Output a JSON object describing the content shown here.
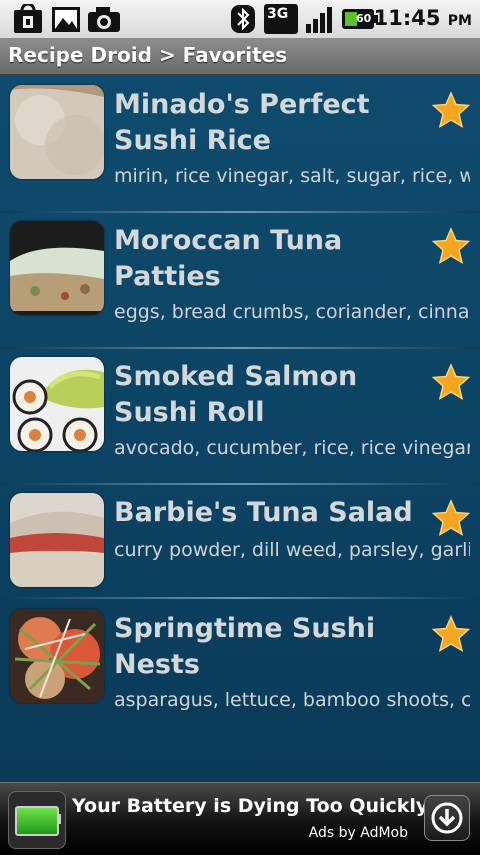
{
  "status_bar": {
    "time": "11:45",
    "ampm": "PM",
    "network": "3G",
    "battery_level": "60",
    "icons": [
      "bag-icon",
      "image-icon",
      "camera-icon",
      "bluetooth-icon",
      "3g-icon",
      "signal-icon",
      "battery-icon"
    ]
  },
  "title_bar": {
    "title": "Recipe Droid > Favorites"
  },
  "recipes": [
    {
      "title_line1": "Minado's Perfect",
      "title_line2": "Sushi Rice",
      "ingredients": "mirin, rice vinegar, salt, sugar, rice, water",
      "favorite": true
    },
    {
      "title_line1": "Moroccan Tuna",
      "title_line2": "Patties",
      "ingredients": "eggs, bread crumbs, coriander, cinnamon",
      "favorite": true
    },
    {
      "title_line1": "Smoked Salmon",
      "title_line2": "Sushi Roll",
      "ingredients": "avocado, cucumber, rice, rice vinegar, salmon",
      "favorite": true
    },
    {
      "title_line1": "Barbie's Tuna Salad",
      "title_line2": "",
      "ingredients": "curry powder, dill weed, parsley, garlic",
      "favorite": true
    },
    {
      "title_line1": "Springtime Sushi",
      "title_line2": "Nests",
      "ingredients": "asparagus, lettuce, bamboo shoots, carrots",
      "favorite": true
    }
  ],
  "ad": {
    "headline": "Your Battery is Dying Too Quickly!",
    "attribution": "Ads by AdMob"
  },
  "colors": {
    "background": "#0b3f5e",
    "title_text": "#d5d8db",
    "star": "#f5a623"
  }
}
